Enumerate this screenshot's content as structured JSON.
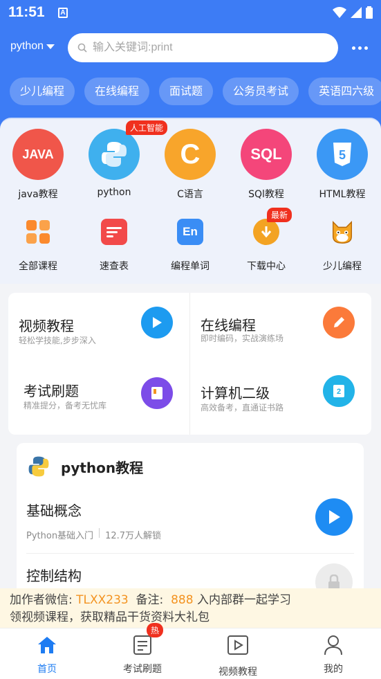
{
  "status_bar": {
    "time": "11:51"
  },
  "header": {
    "language": "python",
    "search_placeholder": "输入关键词:print",
    "chips": [
      "少儿编程",
      "在线编程",
      "面试题",
      "公务员考试",
      "英语四六级"
    ]
  },
  "icon_grid": {
    "row1": [
      {
        "label": "java教程",
        "icon": "java-logo",
        "color": "#f0564a"
      },
      {
        "label": "python",
        "icon": "python-logo",
        "color": "#3fb0ee",
        "badge": "人工智能"
      },
      {
        "label": "C语言",
        "icon": "c-logo",
        "color": "#f8a52b"
      },
      {
        "label": "SQl教程",
        "icon": "sql-logo",
        "color": "#f4467a"
      },
      {
        "label": "HTML教程",
        "icon": "html5-logo",
        "color": "#3b98f5"
      }
    ],
    "row2": [
      {
        "label": "全部课程",
        "icon": "grid-icon",
        "color": "#fb8a2e"
      },
      {
        "label": "速查表",
        "icon": "list-icon",
        "color": "#f24a4a"
      },
      {
        "label": "编程单词",
        "icon": "en-icon",
        "color": "#3a8df5"
      },
      {
        "label": "下载中心",
        "icon": "download-icon",
        "color": "#f3a323",
        "badge": "最新"
      },
      {
        "label": "少儿编程",
        "icon": "scratch-cat-icon",
        "color": "#f5a623"
      }
    ]
  },
  "features": [
    {
      "title": "视频教程",
      "subtitle": "轻松学技能,步步深入",
      "icon": "play-icon",
      "color": "#1d9bf0"
    },
    {
      "title": "在线编程",
      "subtitle": "即时编码，实战演练场",
      "icon": "pencil-icon",
      "color": "#fb7a3a"
    },
    {
      "title": "考试刷题",
      "subtitle": "精准提分，备考无忧库",
      "icon": "book-icon",
      "color": "#7c4ce8"
    },
    {
      "title": "计算机二级",
      "subtitle": "高效备考，直通证书路",
      "icon": "level2-icon",
      "color": "#22b3e8"
    }
  ],
  "course": {
    "title": "python教程",
    "lessons": [
      {
        "title": "基础概念",
        "tag": "Python基础入门",
        "unlocks": "12.7万人解锁",
        "state": "play"
      },
      {
        "title": "控制结构",
        "state": "locked"
      }
    ]
  },
  "promo": {
    "line1_prefix": "加作者微信: ",
    "wechat": "TLXX233",
    "note_label": "  备注:  ",
    "note": "888",
    "line1_suffix": " 入内部群一起学习",
    "line2": "领视频课程，获取精品干货资料大礼包"
  },
  "bottom_nav": [
    {
      "label": "首页",
      "icon": "home-icon",
      "active": true
    },
    {
      "label": "考试刷题",
      "icon": "exam-icon",
      "badge": "热"
    },
    {
      "label": "视频教程",
      "icon": "video-icon"
    },
    {
      "label": "我的",
      "icon": "user-icon"
    }
  ],
  "colors": {
    "primary": "#3d7cf5",
    "accent": "#1e7cf2",
    "badge": "#f0301e",
    "promo": "#f39321"
  }
}
